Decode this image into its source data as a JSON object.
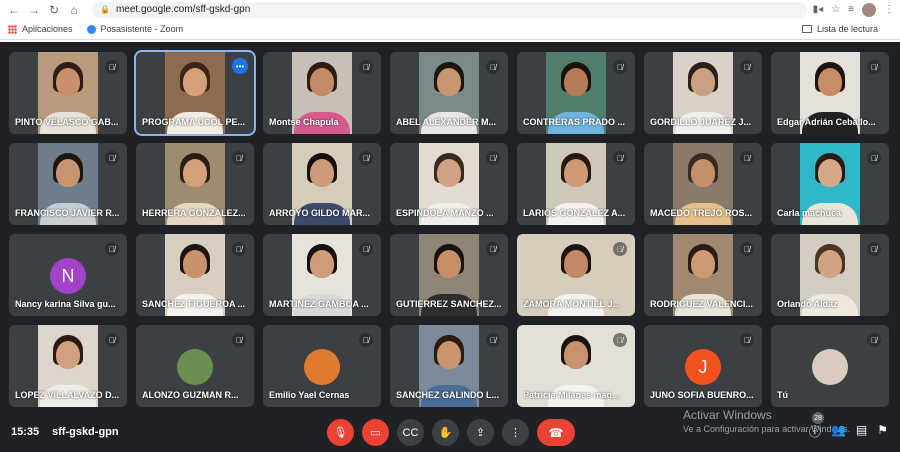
{
  "browser": {
    "url": "meet.google.com/sff-gskd-gpn",
    "bookmarks": [
      "Aplicaciones",
      "Posasistente - Zoom"
    ],
    "reading_list": "Lista de lectura"
  },
  "participants": [
    {
      "name": "PINTO VELASCO GAB...",
      "bg": "#b89a7d",
      "skin": "#c98f6a",
      "hair": "#2b1d16",
      "shirt": "#e8e1d8"
    },
    {
      "name": "PROGRAMA UCOL PE...",
      "bg": "#8d6b4f",
      "skin": "#d6a07a",
      "hair": "#3a2618",
      "shirt": "#f2ece4",
      "active": true
    },
    {
      "name": "Montse Chapula",
      "bg": "#c7c0b4",
      "skin": "#c38b65",
      "hair": "#2d1c12",
      "shirt": "#d65a8c"
    },
    {
      "name": "ABEL ALEXANDER M...",
      "bg": "#7a8a88",
      "skin": "#c9976f",
      "hair": "#1e1511",
      "shirt": "#e7e7e7"
    },
    {
      "name": "CONTRERAS PRADO ...",
      "bg": "#4f7f6a",
      "skin": "#b47b58",
      "hair": "#1b120d",
      "shirt": "#6fb3de"
    },
    {
      "name": "GORDILLO JUAREZ J...",
      "bg": "#d8d2c8",
      "skin": "#caa083",
      "hair": "#2c1f17",
      "shirt": "#f0efeb"
    },
    {
      "name": "Edgar Adrián Ceballo...",
      "bg": "#e5e1da",
      "skin": "#c58d66",
      "hair": "#1c1410",
      "shirt": "#222222"
    },
    {
      "name": "FRANCISCO JAVIER R...",
      "bg": "#6e7d8a",
      "skin": "#c79670",
      "hair": "#1e1611",
      "shirt": "#c7cfd6"
    },
    {
      "name": "HERRERA GONZALEZ...",
      "bg": "#9d8c70",
      "skin": "#d2a07b",
      "hair": "#2b1c13",
      "shirt": "#e4d7c4"
    },
    {
      "name": "ARROYO GILDO MAR...",
      "bg": "#d8cdbb",
      "skin": "#cc9b77",
      "hair": "#161010",
      "shirt": "#3e4a6b"
    },
    {
      "name": "ESPINDOLA MANZO ...",
      "bg": "#e2dbd0",
      "skin": "#d1a283",
      "hair": "#3a2a1e",
      "shirt": "#f1eeea"
    },
    {
      "name": "LARIOS GONZALEZ A...",
      "bg": "#cfc7ba",
      "skin": "#cf9b76",
      "hair": "#251811",
      "shirt": "#f5f2ee"
    },
    {
      "name": "MACEDO TREJO ROS...",
      "bg": "#8a7a6c",
      "skin": "#c48f6a",
      "hair": "#3a2b20",
      "shirt": "#e6c08a"
    },
    {
      "name": "Carla machuca",
      "bg": "#2fb8c7",
      "skin": "#d7a887",
      "hair": "#2a1c14",
      "shirt": "#ece4da"
    },
    {
      "name": "Nancy karina Silva gu...",
      "letter": "N",
      "letter_bg": "#a142c9"
    },
    {
      "name": "SANCHEZ FIGUEROA ...",
      "bg": "#d9cfc0",
      "skin": "#c8926d",
      "hair": "#1b1410",
      "shirt": "#f4f0ea"
    },
    {
      "name": "MARTINEZ GAMBOA ...",
      "bg": "#e7e2da",
      "skin": "#cd9c78",
      "hair": "#151010",
      "shirt": "#d8d8d8"
    },
    {
      "name": "GUTIERREZ SANCHEZ...",
      "bg": "#8f8576",
      "skin": "#c58e67",
      "hair": "#1a1210",
      "shirt": "#2e2e2e"
    },
    {
      "name": "ZAMORA MONTIEL J...",
      "bg": "#d6cdbd",
      "skin": "#c18a65",
      "hair": "#1a130f",
      "shirt": "#f3f1ec",
      "wide": true
    },
    {
      "name": "RODRIGUEZ VALENCI...",
      "bg": "#a08970",
      "skin": "#cc9a75",
      "hair": "#2a1d14",
      "shirt": "#eae3da"
    },
    {
      "name": "Orlando Aldaz",
      "bg": "#d3ccc1",
      "skin": "#d3a483",
      "hair": "#4a3424",
      "shirt": "#efe8de"
    },
    {
      "name": "LOPEZ VILLALVAZO D...",
      "bg": "#ddd6cc",
      "skin": "#d1a080",
      "hair": "#2b1b12",
      "shirt": "#f0ebe4"
    },
    {
      "name": "ALONZO GUZMAN R...",
      "avatar": "#6b8f4e"
    },
    {
      "name": "Emilio Yael Cernas",
      "avatar": "#e07b2e"
    },
    {
      "name": "SANCHEZ GALINDO L...",
      "bg": "#7c8a99",
      "skin": "#c89570",
      "hair": "#2a1c13",
      "shirt": "#4a6d96"
    },
    {
      "name": "Patricia Milanes mag...",
      "bg": "#e4dfd6",
      "skin": "#c89470",
      "hair": "#1c1411",
      "shirt": "#f5f3ef",
      "wide": true
    },
    {
      "name": "JUNO SOFIA BUENRO...",
      "letter": "J",
      "letter_bg": "#f4511e"
    },
    {
      "name": "Tú",
      "avatar": "#d9cbbd"
    }
  ],
  "bottom_bar": {
    "time": "15:35",
    "meeting_code": "sff-gskd-gpn",
    "participant_count": "28",
    "watermark_line1": "Activar Windows",
    "watermark_line2": "Ve a Configuración para activar Windows."
  },
  "colors": {
    "meet_bg": "#202124",
    "tile_bg": "#3c4043",
    "red": "#ea4335",
    "active_outline": "#8ab4f8"
  }
}
